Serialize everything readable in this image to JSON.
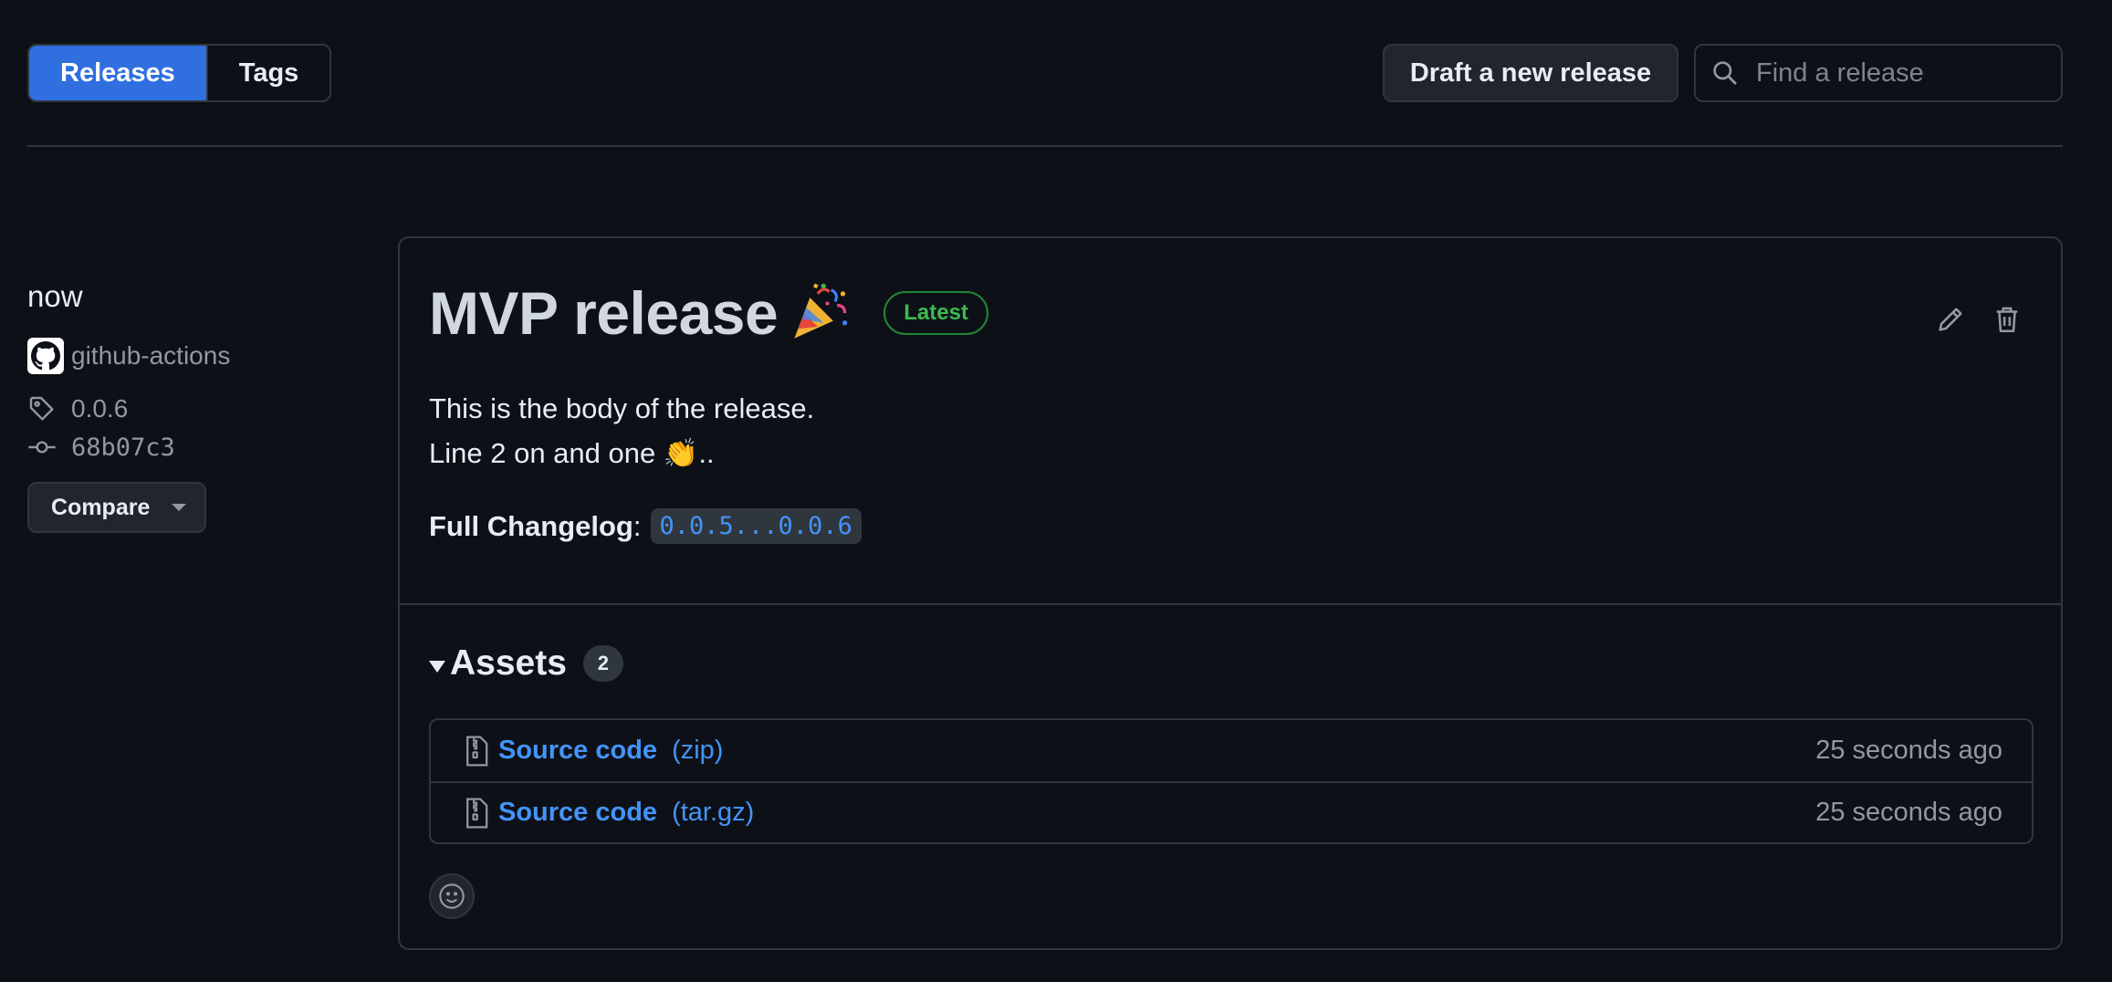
{
  "tabs": [
    {
      "label": "Releases",
      "active": true
    },
    {
      "label": "Tags",
      "active": false
    }
  ],
  "toolbar": {
    "draft_label": "Draft a new release",
    "search_placeholder": "Find a release"
  },
  "sidebar": {
    "time": "now",
    "author": "github-actions",
    "tag": "0.0.6",
    "commit": "68b07c3",
    "compare_label": "Compare"
  },
  "release": {
    "title": "MVP release",
    "title_icon": "party-popper-icon",
    "badge": "Latest",
    "body_line1": "This is the body of the release.",
    "body_line2": "Line 2 on and one 👏..",
    "changelog_label": "Full Changelog",
    "changelog_link": "0.0.5...0.0.6"
  },
  "assets": {
    "title": "Assets",
    "count": "2",
    "items": [
      {
        "name": "Source code",
        "format": "(zip)",
        "time": "25 seconds ago"
      },
      {
        "name": "Source code",
        "format": "(tar.gz)",
        "time": "25 seconds ago"
      }
    ]
  },
  "colors": {
    "background": "#0d1117",
    "accent": "#2f6fdf",
    "link": "#4493f8",
    "latest_badge": "#3fb950",
    "border": "#30363d"
  }
}
